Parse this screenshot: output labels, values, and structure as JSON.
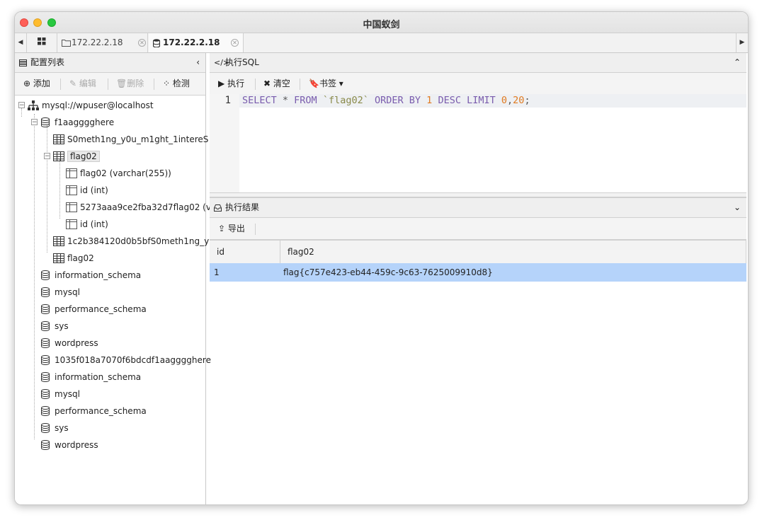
{
  "window": {
    "title": "中国蚁剑"
  },
  "tabs": [
    {
      "label": "172.22.2.18",
      "icon": "folder-icon",
      "active": false
    },
    {
      "label": "172.22.2.18",
      "icon": "database-icon",
      "active": true
    }
  ],
  "left_panel": {
    "title": "配置列表",
    "toolbar": {
      "add": "添加",
      "edit": "编辑",
      "delete": "删除",
      "check": "检测"
    }
  },
  "tree": {
    "root": "mysql://wpuser@localhost",
    "items": [
      {
        "label": "f1aagggghere",
        "type": "database"
      },
      {
        "label": "S0meth1ng_y0u_m1ght_1intereS",
        "type": "table"
      },
      {
        "label": "flag02",
        "type": "table"
      },
      {
        "label": "flag02 (varchar(255))",
        "type": "column"
      },
      {
        "label": "id (int)",
        "type": "column"
      },
      {
        "label": "5273aaa9ce2fba32d7flag02 (v",
        "type": "column"
      },
      {
        "label": "id (int)",
        "type": "column"
      },
      {
        "label": "1c2b384120d0b5bfS0meth1ng_y",
        "type": "table"
      },
      {
        "label": "flag02",
        "type": "table"
      },
      {
        "label": "information_schema",
        "type": "database"
      },
      {
        "label": "mysql",
        "type": "database"
      },
      {
        "label": "performance_schema",
        "type": "database"
      },
      {
        "label": "sys",
        "type": "database"
      },
      {
        "label": "wordpress",
        "type": "database"
      },
      {
        "label": "1035f018a7070f6bdcdf1aagggghere",
        "type": "database"
      },
      {
        "label": "information_schema",
        "type": "database"
      },
      {
        "label": "mysql",
        "type": "database"
      },
      {
        "label": "performance_schema",
        "type": "database"
      },
      {
        "label": "sys",
        "type": "database"
      },
      {
        "label": "wordpress",
        "type": "database"
      }
    ]
  },
  "sql_panel": {
    "title": "执行SQL",
    "toolbar": {
      "execute": "执行",
      "clear": "清空",
      "bookmark": "书签"
    },
    "line_number": "1",
    "code": {
      "t1": "SELECT",
      "t2": " * ",
      "t3": "FROM",
      "t4": " ",
      "t5": "`flag02`",
      "t6": " ",
      "t7": "ORDER BY",
      "t8": " ",
      "t9": "1",
      "t10": " ",
      "t11": "DESC",
      "t12": " ",
      "t13": "LIMIT",
      "t14": " ",
      "t15": "0",
      "t16": ",",
      "t17": "20",
      "t18": ";"
    }
  },
  "result_panel": {
    "title": "执行结果",
    "toolbar": {
      "export": "导出"
    },
    "columns": [
      "id",
      "flag02"
    ],
    "rows": [
      [
        "1",
        "flag{c757e423-eb44-459c-9c63-7625009910d8}"
      ]
    ]
  },
  "colors": {
    "selected_row": "#b5d3fa",
    "keyword": "#7a5cad",
    "number": "#e07b22"
  }
}
